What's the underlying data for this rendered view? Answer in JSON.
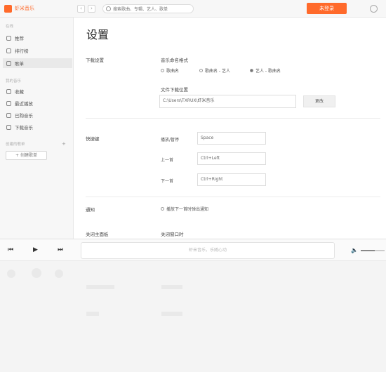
{
  "app": {
    "name": "虾米音乐"
  },
  "topbar": {
    "back": "‹",
    "forward": "›",
    "search_placeholder": "搜索歌曲、专辑、艺人、歌单",
    "login": "未登录"
  },
  "sidebar": {
    "section_online": "在线",
    "items_online": [
      {
        "label": "推荐"
      },
      {
        "label": "排行榜"
      },
      {
        "label": "歌单"
      }
    ],
    "section_mine": "我的音乐",
    "items_mine": [
      {
        "label": "收藏"
      },
      {
        "label": "最近播放"
      },
      {
        "label": "已购音乐"
      },
      {
        "label": "下载音乐"
      }
    ],
    "section_created": "创建的歌单",
    "add_playlist": "+",
    "create_playlist": "+ 创建歌单"
  },
  "settings": {
    "title": "设置",
    "download": {
      "label": "下载设置",
      "naming_label": "音乐命名格式",
      "options": [
        "歌曲名",
        "歌曲名 - 艺人",
        "艺人 - 歌曲名"
      ],
      "selected_index": 2,
      "dir_label": "文件下载位置",
      "dir_value": "C:\\Users\\TXRUX\\虾米音乐",
      "change_button": "更改"
    },
    "shortcuts": {
      "label": "快捷键",
      "rows": [
        {
          "name": "播放/暂停",
          "key": "Space"
        },
        {
          "name": "上一首",
          "key": "Ctrl+Left"
        },
        {
          "name": "下一首",
          "key": "Ctrl+Right"
        }
      ]
    },
    "notify": {
      "label": "通知",
      "option": "播放下一首时弹出通知"
    },
    "close": {
      "label": "关闭主面板",
      "option": "关闭窗口时"
    }
  },
  "player": {
    "prev": "⏮",
    "play": "▶",
    "next": "⏭",
    "lyrics_placeholder": "虾米音乐，乐随心动",
    "volume_icon": "🔈",
    "volume_level": 0.6
  }
}
